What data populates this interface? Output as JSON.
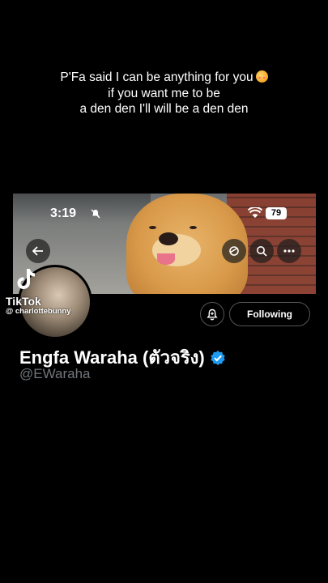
{
  "caption": {
    "line1": "P'Fa said I can be anything for you",
    "line2": "if you want me to be",
    "line3": "a den den I'll will be a den den"
  },
  "status_bar": {
    "time": "3:19",
    "battery": "79"
  },
  "watermark": {
    "app": "TikTok",
    "handle": "@ charlottebunny"
  },
  "profile": {
    "name": "Engfa Waraha (ตัวจริง)",
    "handle": "@EWaraha",
    "follow_label": "Following"
  },
  "icons": [
    "back-arrow-icon",
    "refresh-icon",
    "search-icon",
    "more-icon",
    "bell-off-icon",
    "wifi-icon",
    "notification-bell-icon",
    "verified-icon",
    "tiktok-logo-icon",
    "emoji-icon"
  ],
  "colors": {
    "background": "#000000",
    "verified": "#1d9bf0",
    "handle": "#71767b"
  }
}
